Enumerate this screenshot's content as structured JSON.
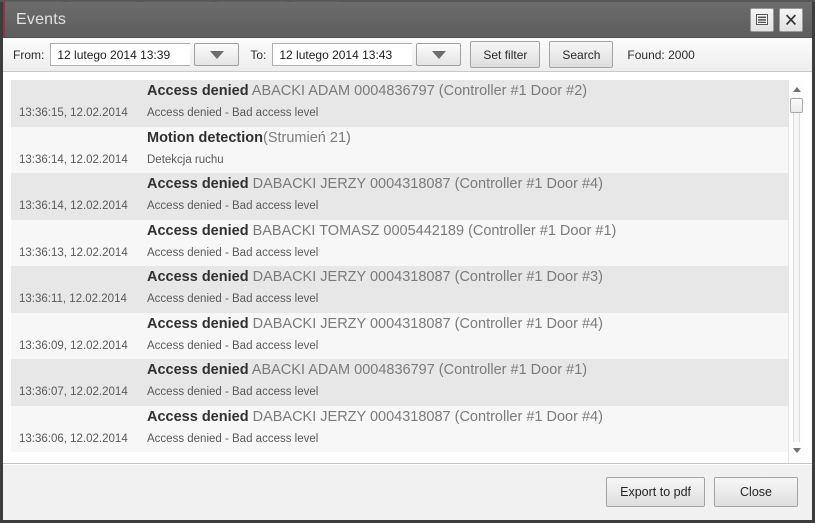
{
  "window": {
    "title": "Events",
    "buttons": {
      "restore_icon": "window-restore-icon",
      "close_icon": "close-icon",
      "close_glyph": "✕"
    }
  },
  "filter_bar": {
    "from_label": "From:",
    "from_value": "12 lutego 2014 13:39",
    "from_placeholder": "12 lutego 2014 13:39",
    "to_label": "To:",
    "to_value": "12 lutego 2014 13:43",
    "to_placeholder": "12 lutego 2014 13:43",
    "dropdown_icon": "chevron-down-icon",
    "set_filter_label": "Set filter",
    "search_label": "Search",
    "found_label": "Found: 2000"
  },
  "events": [
    {
      "title": "Access denied",
      "detail": " ABACKI ADAM 0004836797 (Controller #1 Door #2)",
      "time": "13:36:15, 12.02.2014",
      "description": "Access denied - Bad access level"
    },
    {
      "title": "Motion detection",
      "detail": "(Strumień 21)",
      "time": "13:36:14, 12.02.2014",
      "description": "Detekcja ruchu"
    },
    {
      "title": "Access denied",
      "detail": " DABACKI JERZY 0004318087 (Controller #1 Door #4)",
      "time": "13:36:14, 12.02.2014",
      "description": "Access denied - Bad access level"
    },
    {
      "title": "Access denied",
      "detail": " BABACKI TOMASZ 0005442189 (Controller #1 Door #1)",
      "time": "13:36:13, 12.02.2014",
      "description": "Access denied - Bad access level"
    },
    {
      "title": "Access denied",
      "detail": " DABACKI JERZY 0004318087 (Controller #1 Door #3)",
      "time": "13:36:11, 12.02.2014",
      "description": "Access denied - Bad access level"
    },
    {
      "title": "Access denied",
      "detail": " DABACKI JERZY 0004318087 (Controller #1 Door #4)",
      "time": "13:36:09, 12.02.2014",
      "description": "Access denied - Bad access level"
    },
    {
      "title": "Access denied",
      "detail": " ABACKI ADAM 0004836797 (Controller #1 Door #1)",
      "time": "13:36:07, 12.02.2014",
      "description": "Access denied - Bad access level"
    },
    {
      "title": "Access denied",
      "detail": " DABACKI JERZY 0004318087 (Controller #1 Door #4)",
      "time": "13:36:06, 12.02.2014",
      "description": "Access denied - Bad access level"
    }
  ],
  "scrollbar": {
    "up_icon": "scroll-up-arrow-icon",
    "down_icon": "scroll-down-arrow-icon"
  },
  "footer": {
    "export_label": "Export to pdf",
    "close_label": "Close"
  },
  "colors": {
    "titlebar": "#646464",
    "accent": "#8f3346",
    "window_border": "#3d3d3d",
    "row_odd": "#e7e7e7",
    "row_even": "#f7f7f7",
    "title_strong": "#303030",
    "title_muted": "#7b7b7b"
  }
}
